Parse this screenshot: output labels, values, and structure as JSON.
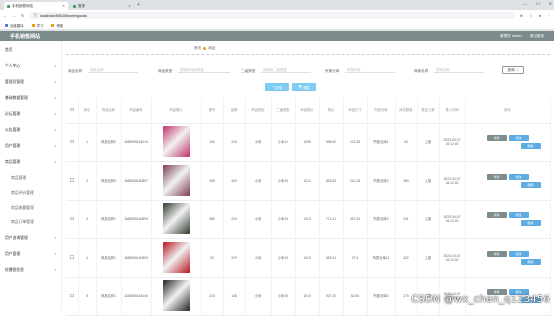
{
  "browser": {
    "tabs": [
      {
        "label": "手机销售网站",
        "active": true
      },
      {
        "label": "登录",
        "active": false
      }
    ],
    "new_tab": "+",
    "url": "localhost:8081/#/home/goods",
    "bookmarks": [
      "百度翻译",
      "学习",
      "博客"
    ]
  },
  "app": {
    "brand": "手机销售网站",
    "user_label": "管理员 admin",
    "logout": "退出登录"
  },
  "sidebar": [
    {
      "label": "首页"
    },
    {
      "label": "个人中心"
    },
    {
      "label": "管理员管理"
    },
    {
      "label": "基础数据管理"
    },
    {
      "label": "论坛管理"
    },
    {
      "label": "公告管理"
    },
    {
      "label": "用户管理"
    },
    {
      "label": "商品管理"
    },
    {
      "label": "商品管理",
      "sub": true
    },
    {
      "label": "商品评价管理",
      "sub": true
    },
    {
      "label": "商品收藏管理",
      "sub": true
    },
    {
      "label": "商品订单管理",
      "sub": true
    },
    {
      "label": "用户咨询管理"
    },
    {
      "label": "用户管理"
    },
    {
      "label": "轮播图信息"
    }
  ],
  "breadcrumb": {
    "home": "首页",
    "current": "商品"
  },
  "filters": [
    {
      "label": "商品名称",
      "placeholder": "商品名称"
    },
    {
      "label": "商品类型",
      "placeholder": "请选择商品类型"
    },
    {
      "label": "二级类型",
      "placeholder": "请选择二级类型"
    },
    {
      "label": "所属仓库",
      "placeholder": "所属仓库"
    },
    {
      "label": "商家名称",
      "placeholder": "商家名称"
    }
  ],
  "search_button": "查询",
  "actions": {
    "add": "新增",
    "delete": "删除"
  },
  "table": {
    "headers": [
      "",
      "索引",
      "商品名称",
      "商品编号",
      "商品照片",
      "型号",
      "品牌",
      "商品类型",
      "二级类型",
      "商品原价",
      "现价",
      "商品尺寸",
      "所属仓库",
      "库存数量",
      "是否上架",
      "录入时间",
      "操作"
    ],
    "row_buttons": {
      "detail": "详情",
      "edit": "修改",
      "delete": "删除"
    },
    "rows": [
      {
        "index": "1",
        "name": "商品名称2",
        "code": "1680055161014",
        "model": "150",
        "brand": "416",
        "type": "小米",
        "subtype": "小米11",
        "orig_price": "1006",
        "price": "696.92",
        "size": "222.35",
        "warehouse": "所属仓库1",
        "stock": "40",
        "status": "上架",
        "time": "2023-04-07 16:12:40",
        "thumb": "#c0306a"
      },
      {
        "index": "2",
        "name": "商品名称3",
        "code": "1680055160897",
        "model": "435",
        "brand": "404",
        "type": "小米",
        "subtype": "小米10",
        "orig_price": "1012",
        "price": "803.83",
        "size": "210.16",
        "warehouse": "所属仓库3",
        "stock": "380",
        "status": "上架",
        "time": "2023-04-07 16:12:40",
        "thumb": "#7a3b52"
      },
      {
        "index": "3",
        "name": "商品名称1",
        "code": "1680055160994",
        "model": "386",
        "brand": "224",
        "type": "小米",
        "subtype": "小米10",
        "orig_price": "1013",
        "price": "771.21",
        "size": "397.34",
        "warehouse": "所属仓库3",
        "stock": "331",
        "status": "上架",
        "time": "2023-04-07 16:12:40",
        "thumb": "#2e3a2f"
      },
      {
        "index": "4",
        "name": "商品名称1",
        "code": "1680055160993",
        "model": "92",
        "brand": "379",
        "type": "小米",
        "subtype": "小米10",
        "orig_price": "1013",
        "price": "659.31",
        "size": "37.6",
        "warehouse": "所属仓库11",
        "stock": "422",
        "status": "上架",
        "time": "2023-04-07 16:12:40",
        "thumb": "#b8121c"
      },
      {
        "index": "5",
        "name": "商品名称1",
        "code": "1680055161040",
        "model": "210",
        "brand": "146",
        "type": "小米",
        "subtype": "小米10",
        "orig_price": "1010",
        "price": "927.20",
        "size": "52.84",
        "warehouse": "所属仓库5",
        "stock": "270",
        "status": "上架",
        "time": "2023-04-07 16:12:40",
        "thumb": "#222222"
      }
    ]
  },
  "watermark": "CSDN @wx_chen_q123456"
}
